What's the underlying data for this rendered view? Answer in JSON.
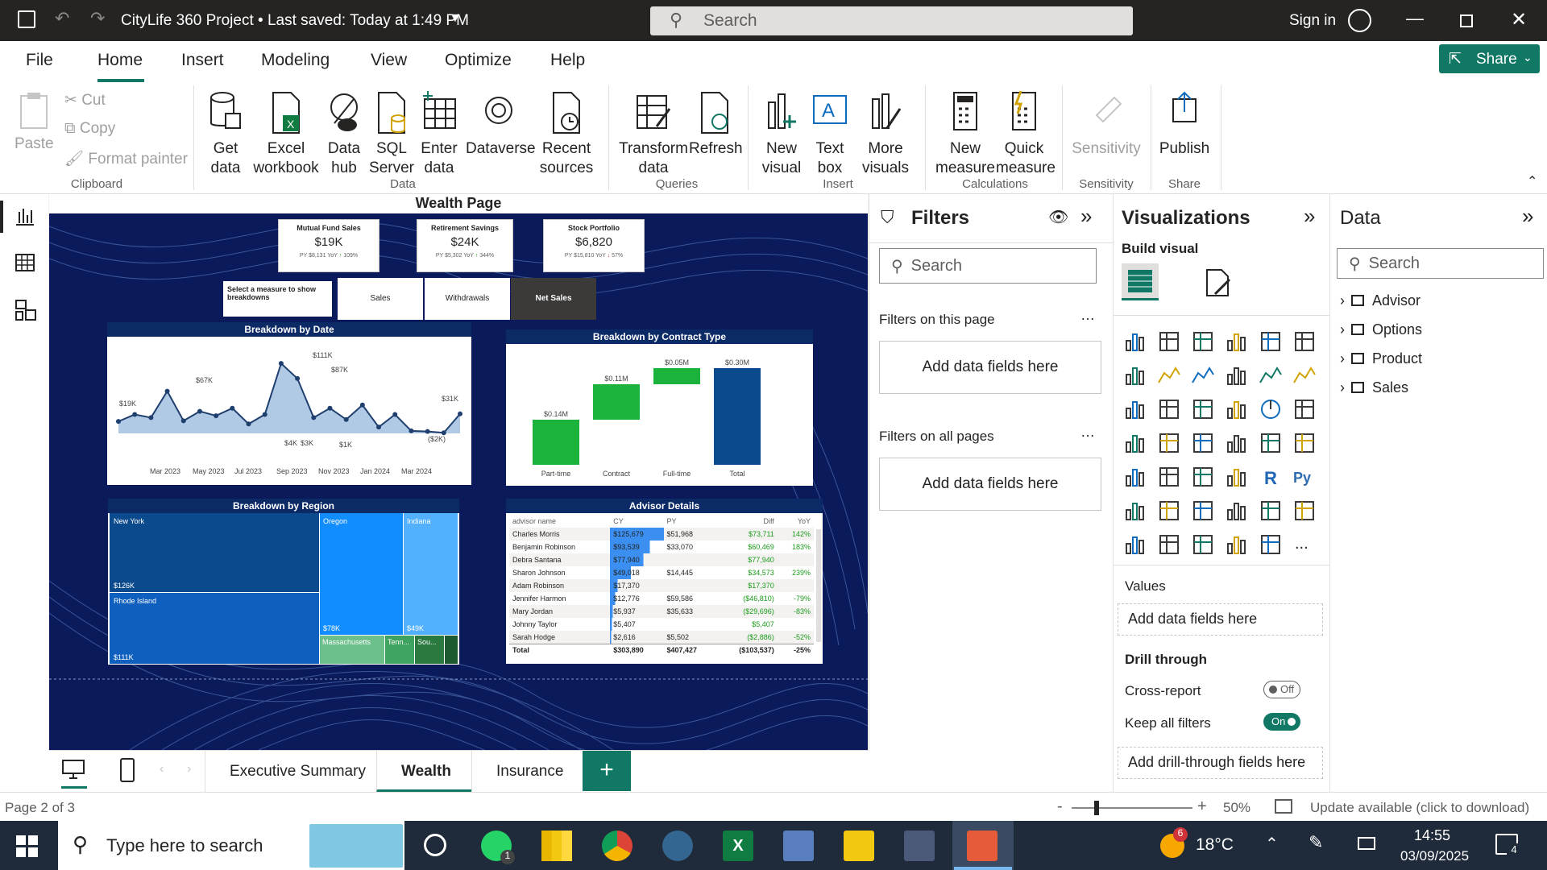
{
  "titlebar": {
    "title": "CityLife 360 Project • Last saved: Today at 1:49 PM",
    "search": "Search",
    "sign_in": "Sign in"
  },
  "tabs": {
    "file": "File",
    "home": "Home",
    "insert": "Insert",
    "modeling": "Modeling",
    "view": "View",
    "optimize": "Optimize",
    "help": "Help",
    "share": "Share"
  },
  "ribbon": {
    "paste": "Paste",
    "cut": "Cut",
    "copy": "Copy",
    "format_painter": "Format painter",
    "clipboard": "Clipboard",
    "get_data": "Get data",
    "excel": "Excel workbook",
    "data_hub": "Data hub",
    "sql": "SQL Server",
    "enter_data": "Enter data",
    "dataverse": "Dataverse",
    "recent": "Recent sources",
    "data": "Data",
    "transform": "Transform data",
    "refresh": "Refresh",
    "queries": "Queries",
    "new_visual": "New visual",
    "text_box": "Text box",
    "more_visuals": "More visuals",
    "insert": "Insert",
    "new_measure": "New measure",
    "quick_measure": "Quick measure",
    "calculations": "Calculations",
    "sensitivity": "Sensitivity",
    "sensitivity_grp": "Sensitivity",
    "publish": "Publish",
    "share_grp": "Share"
  },
  "report": {
    "title": "Wealth Page",
    "cards": [
      {
        "label": "Mutual Fund Sales",
        "value": "$19K",
        "py": "PY",
        "pyv": "$8,131",
        "yoy": "YoY",
        "pct": "109%"
      },
      {
        "label": "Retirement Savings",
        "value": "$24K",
        "py": "PY",
        "pyv": "$5,302",
        "yoy": "YoY",
        "pct": "344%"
      },
      {
        "label": "Stock Portfolio",
        "value": "$6,820",
        "py": "PY",
        "pyv": "$15,810",
        "yoy": "YoY",
        "pct": "57%"
      }
    ],
    "measure_prompt": "Select a measure to show breakdowns",
    "measures": [
      "Sales",
      "Withdrawals",
      "Net Sales"
    ],
    "date_title": "Breakdown by Date",
    "date_labels": {
      "a": "$19K",
      "b": "$67K",
      "c": "$111K",
      "d": "$87K",
      "e": "$31K",
      "f": "$4K",
      "g": "$3K",
      "h": "$1K",
      "i": "($2K)"
    },
    "date_ticks": [
      "Mar 2023",
      "May 2023",
      "Jul 2023",
      "Sep 2023",
      "Nov 2023",
      "Jan 2024",
      "Mar 2024"
    ],
    "contract_title": "Breakdown by Contract Type",
    "region_title": "Breakdown by Region",
    "regions": {
      "ny": "New York",
      "ny_v": "$126K",
      "ri": "Rhode Island",
      "ri_v": "$111K",
      "or": "Oregon",
      "or_v": "$78K",
      "in": "Indiana",
      "in_v": "$49K",
      "ma": "Massachusetts",
      "tn": "Tenn...",
      "so": "Sou..."
    },
    "advisor_title": "Advisor Details",
    "advisor_headers": [
      "advisor name",
      "CY",
      "PY",
      "Diff",
      "YoY"
    ],
    "advisors": [
      [
        "Charles Morris",
        "$125,679",
        "$51,968",
        "$73,711",
        "142%"
      ],
      [
        "Benjamin Robinson",
        "$93,539",
        "$33,070",
        "$60,469",
        "183%"
      ],
      [
        "Debra Santana",
        "$77,940",
        "",
        "$77,940",
        ""
      ],
      [
        "Sharon Johnson",
        "$49,018",
        "$14,445",
        "$34,573",
        "239%"
      ],
      [
        "Adam Robinson",
        "$17,370",
        "",
        "$17,370",
        ""
      ],
      [
        "Jennifer Harmon",
        "$12,776",
        "$59,586",
        "($46,810)",
        "-79%"
      ],
      [
        "Mary Jordan",
        "$5,937",
        "$35,633",
        "($29,696)",
        "-83%"
      ],
      [
        "Johnny Taylor",
        "$5,407",
        "",
        "$5,407",
        ""
      ],
      [
        "Sarah Hodge",
        "$2,616",
        "$5,502",
        "($2,886)",
        "-52%"
      ]
    ],
    "advisor_total": [
      "Total",
      "$303,890",
      "$407,427",
      "($103,537)",
      "-25%"
    ]
  },
  "chart_data": [
    {
      "type": "line",
      "title": "Breakdown by Date",
      "x": [
        "Mar 2023",
        "May 2023",
        "Jul 2023",
        "Sep 2023",
        "Nov 2023",
        "Jan 2024",
        "Mar 2024"
      ],
      "series": [
        {
          "values": [
            19,
            30,
            25,
            67,
            20,
            35,
            28,
            40,
            15,
            30,
            111,
            87,
            25,
            40,
            22,
            45,
            10,
            30,
            4,
            3,
            1,
            31
          ]
        }
      ],
      "y_unit": "$K"
    },
    {
      "type": "bar",
      "title": "Breakdown by Contract Type",
      "categories": [
        "Part-time",
        "Contract",
        "Full-time",
        "Total"
      ],
      "values": [
        0.14,
        0.11,
        0.05,
        0.3
      ],
      "labels": [
        "$0.14M",
        "$0.11M",
        "$0.05M",
        "$0.30M"
      ]
    }
  ],
  "filters": {
    "title": "Filters",
    "search": "Search",
    "on_page": "Filters on this page",
    "on_all": "Filters on all pages",
    "add": "Add data fields here"
  },
  "viz": {
    "title": "Visualizations",
    "build": "Build visual",
    "values": "Values",
    "add": "Add data fields here",
    "drill": "Drill through",
    "cross": "Cross-report",
    "cross_state": "Off",
    "keep": "Keep all filters",
    "keep_state": "On",
    "add_drill": "Add drill-through fields here"
  },
  "datapane": {
    "title": "Data",
    "search": "Search",
    "tables": [
      "Advisor",
      "Options",
      "Product",
      "Sales"
    ]
  },
  "pages": {
    "exec": "Executive Summary",
    "wealth": "Wealth",
    "insurance": "Insurance"
  },
  "status": {
    "page": "Page 2 of 3",
    "zoom": "50%",
    "update": "Update available (click to download)"
  },
  "taskbar": {
    "search": "Type here to search",
    "temp": "18°C",
    "time": "14:55",
    "date": "03/09/2025",
    "notif": "4",
    "weather_badge": "6",
    "whatsapp_badge": "1"
  },
  "colors": {
    "accent": "#117865",
    "report_bg": "#0b1a5a"
  }
}
